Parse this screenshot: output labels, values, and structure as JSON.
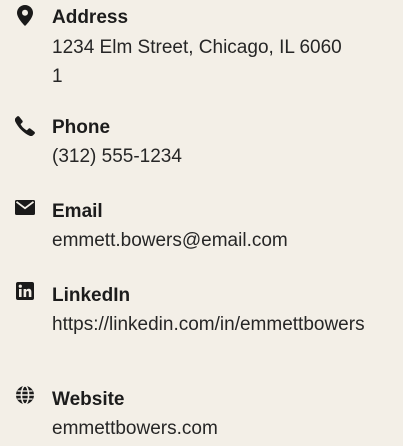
{
  "contacts": {
    "address": {
      "label": "Address",
      "value": "1234 Elm Street, Chicago, IL 60601",
      "icon": "map-marker-icon"
    },
    "phone": {
      "label": "Phone",
      "value": "(312) 555-1234",
      "icon": "phone-icon"
    },
    "email": {
      "label": "Email",
      "value": "emmett.bowers@email.com",
      "icon": "envelope-icon"
    },
    "linkedin": {
      "label": "LinkedIn",
      "value": "https://linkedin.com/in/emmettbowers",
      "icon": "linkedin-icon"
    },
    "website": {
      "label": "Website",
      "value": "emmettbowers.com",
      "icon": "globe-icon"
    }
  },
  "colors": {
    "background": "#f3efe7",
    "text": "#1f1f1f",
    "icon": "#1a1a1a"
  }
}
